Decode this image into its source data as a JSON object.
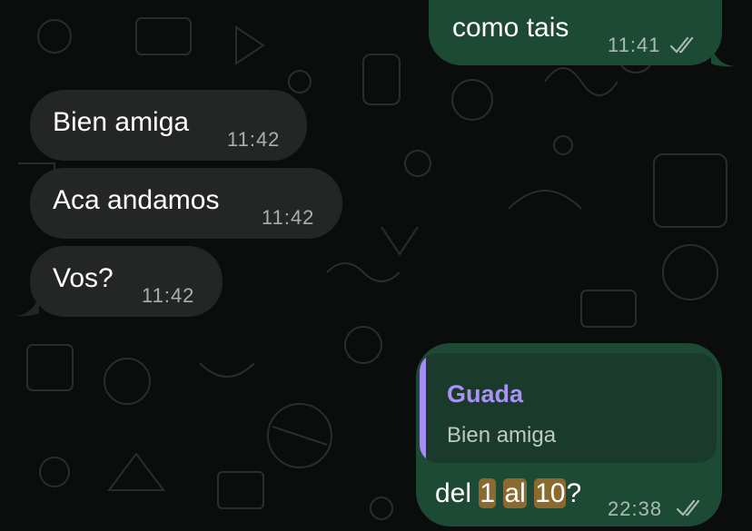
{
  "messages": [
    {
      "text": "como tais",
      "time": "11:41",
      "direction": "outgoing",
      "status": "read"
    },
    {
      "text": "Bien amiga",
      "time": "11:42",
      "direction": "incoming"
    },
    {
      "text": "Aca andamos",
      "time": "11:42",
      "direction": "incoming"
    },
    {
      "text": "Vos?",
      "time": "11:42",
      "direction": "incoming"
    },
    {
      "direction": "outgoing",
      "status": "read",
      "time": "22:38",
      "reply": {
        "author": "Guada",
        "text": "Bien amiga"
      },
      "parts": {
        "a": "del ",
        "b": "1",
        "c": " ",
        "d": "al",
        "e": " ",
        "f": "10",
        "g": "?"
      }
    }
  ],
  "colors": {
    "outgoing_bubble": "#1c4a35",
    "incoming_bubble": "#242626",
    "reply_author": "#a993f4",
    "search_highlight": "#8a6a2e",
    "background": "#0b0d0c"
  }
}
